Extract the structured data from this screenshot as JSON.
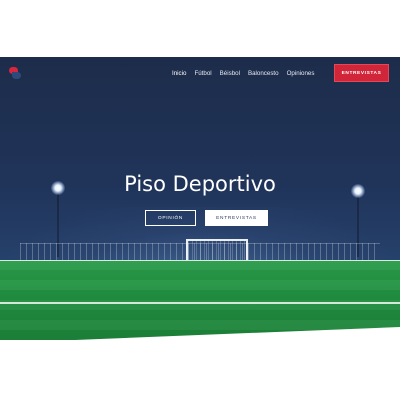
{
  "brand": {
    "logo_colors": {
      "primary": "#d7263d",
      "secondary": "#2e4a7a"
    }
  },
  "nav": {
    "items": [
      {
        "label": "Inicio",
        "active": true
      },
      {
        "label": "Fútbol",
        "active": false
      },
      {
        "label": "Béisbol",
        "active": false
      },
      {
        "label": "Baloncesto",
        "active": false
      },
      {
        "label": "Opiniones",
        "active": false
      }
    ],
    "cta_label": "ENTREVISTAS",
    "cta_color": "#d1263a"
  },
  "hero": {
    "title": "Piso Deportivo",
    "buttons": {
      "primary_label": "OPINIÓN",
      "secondary_label": "ENTREVISTAS"
    },
    "background": {
      "sky_color": "#1d2c4a",
      "field_color": "#239443"
    }
  },
  "icons": {
    "logo": "brand-logo-icon",
    "stadium_lights": "stadium-light-icon",
    "goal": "soccer-goal-icon"
  }
}
